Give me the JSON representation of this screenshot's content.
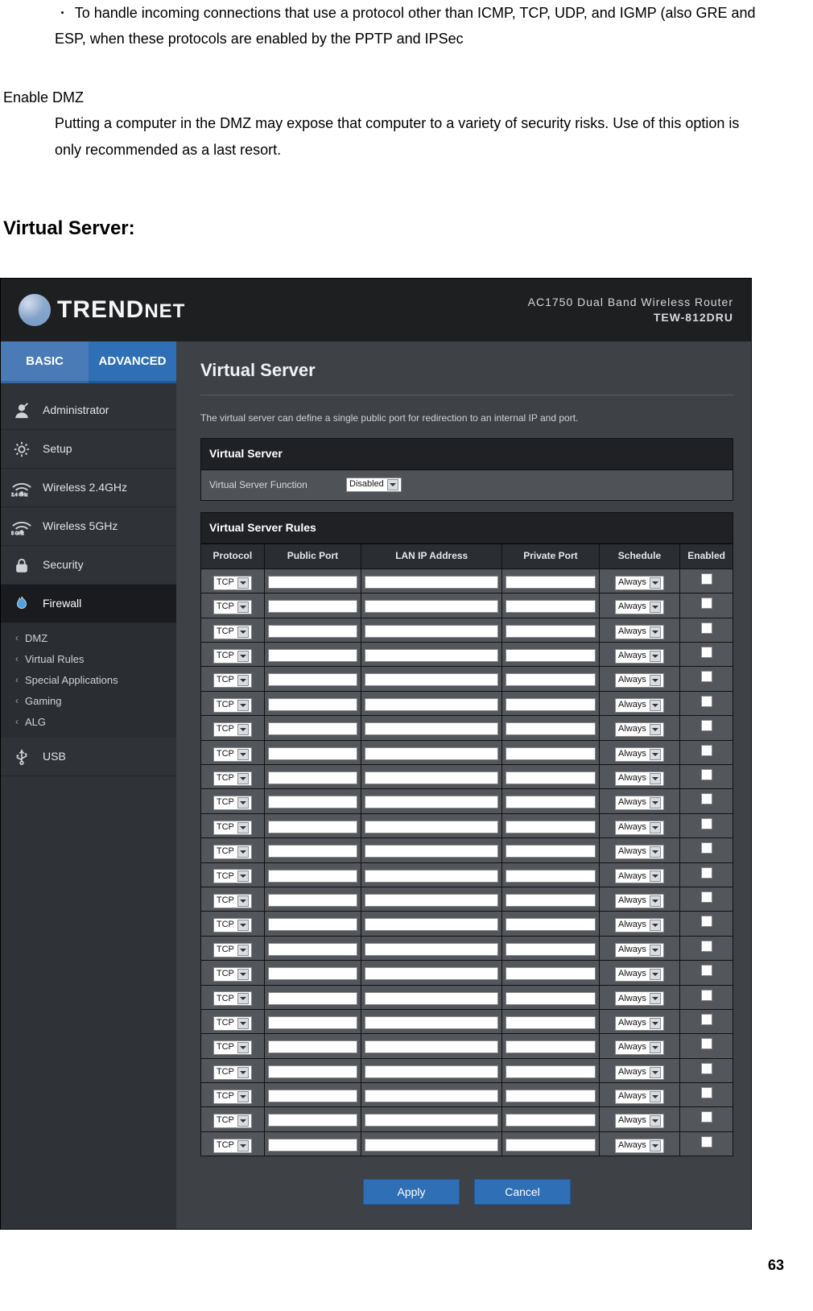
{
  "doc": {
    "bullet": "To handle incoming connections that use a protocol other than ICMP, TCP, UDP, and IGMP (also GRE and ESP, when these protocols are enabled by the PPTP and IPSec",
    "enable_dmz_heading": "Enable DMZ",
    "enable_dmz_text": "Putting a computer in the DMZ may expose that computer to a variety of security risks. Use of this option is only recommended as a last resort.",
    "virtual_server_heading": "Virtual Server:",
    "page_number": "63"
  },
  "router": {
    "brand": "TRENDNET",
    "product_line": "AC1750 Dual Band Wireless Router",
    "model_number": "TEW-812DRU",
    "tabs": {
      "basic": "BASIC",
      "advanced": "ADVANCED"
    },
    "nav": {
      "administrator": "Administrator",
      "setup": "Setup",
      "wireless24": "Wireless 2.4GHz",
      "wireless5": "Wireless 5GHz",
      "security": "Security",
      "firewall": "Firewall",
      "usb": "USB",
      "firewall_sub": [
        "DMZ",
        "Virtual Rules",
        "Special Applications",
        "Gaming",
        "ALG"
      ]
    },
    "page": {
      "title": "Virtual Server",
      "desc": "The virtual server can define a single public port for redirection to an internal IP and port.",
      "panel1_title": "Virtual Server",
      "vs_function_label": "Virtual Server Function",
      "vs_function_value": "Disabled",
      "panel2_title": "Virtual Server Rules",
      "columns": [
        "Protocol",
        "Public Port",
        "LAN IP Address",
        "Private Port",
        "Schedule",
        "Enabled"
      ],
      "row_defaults": {
        "protocol": "TCP",
        "schedule": "Always"
      },
      "row_count": 24,
      "apply": "Apply",
      "cancel": "Cancel"
    }
  }
}
